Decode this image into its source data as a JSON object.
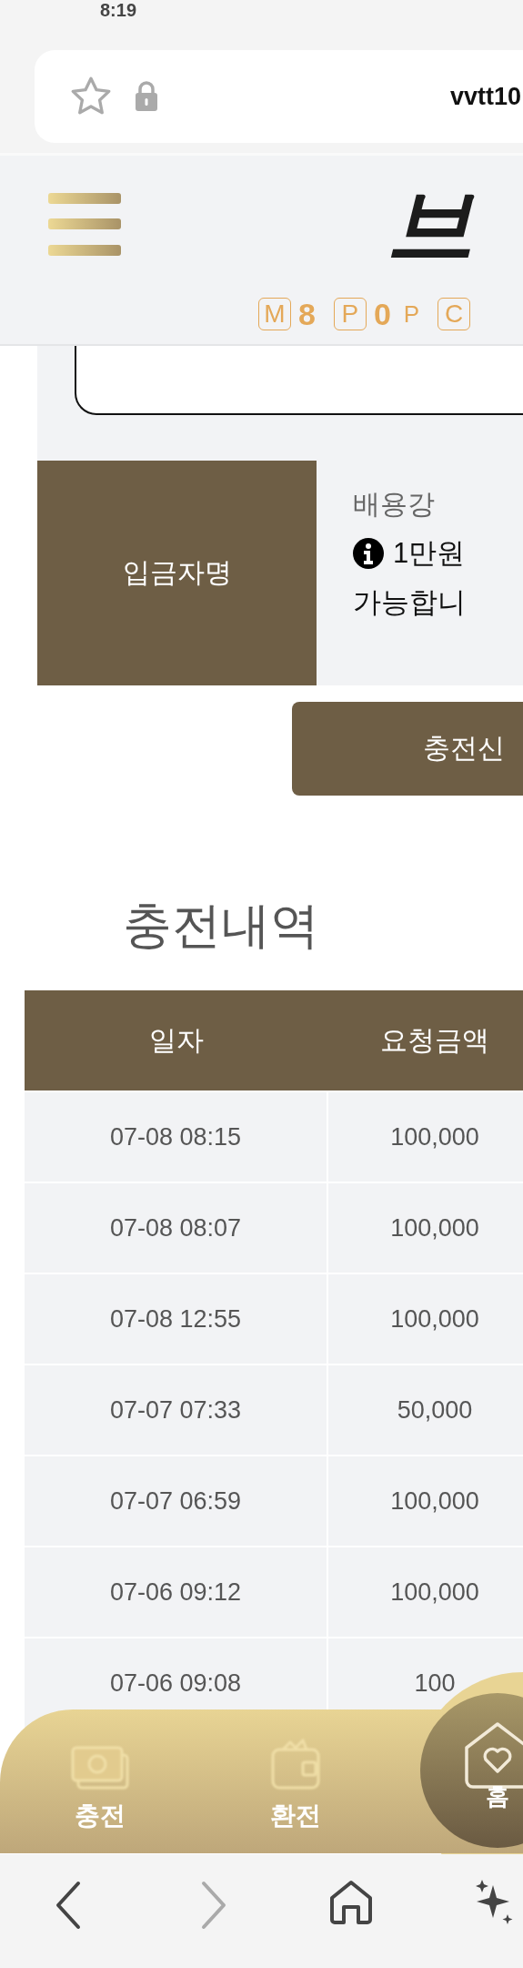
{
  "status_bar": {
    "time": "8:19"
  },
  "address_bar": {
    "url": "vvtt10"
  },
  "header": {
    "logo": "브",
    "points": [
      {
        "icon": "M",
        "value": "8"
      },
      {
        "icon": "P",
        "value": "0",
        "unit": "P"
      },
      {
        "icon": "C"
      }
    ]
  },
  "form": {
    "depositor": {
      "label": "입금자명",
      "value": "배용강",
      "notice_lines": [
        "1만원",
        "가능합니"
      ]
    },
    "submit": "충전신"
  },
  "history": {
    "title": "충전내역",
    "columns": [
      "일자",
      "요청금액"
    ],
    "rows": [
      [
        "07-08 08:15",
        "100,000"
      ],
      [
        "07-08 08:07",
        "100,000"
      ],
      [
        "07-08 12:55",
        "100,000"
      ],
      [
        "07-07 07:33",
        "50,000"
      ],
      [
        "07-07 06:59",
        "100,000"
      ],
      [
        "07-06 09:12",
        "100,000"
      ],
      [
        "07-06 09:08",
        "100"
      ]
    ]
  },
  "bottom_nav": [
    {
      "kind": "cash",
      "label": "충전"
    },
    {
      "kind": "wallet",
      "label": "환전"
    },
    {
      "kind": "home",
      "label": "홈"
    }
  ]
}
